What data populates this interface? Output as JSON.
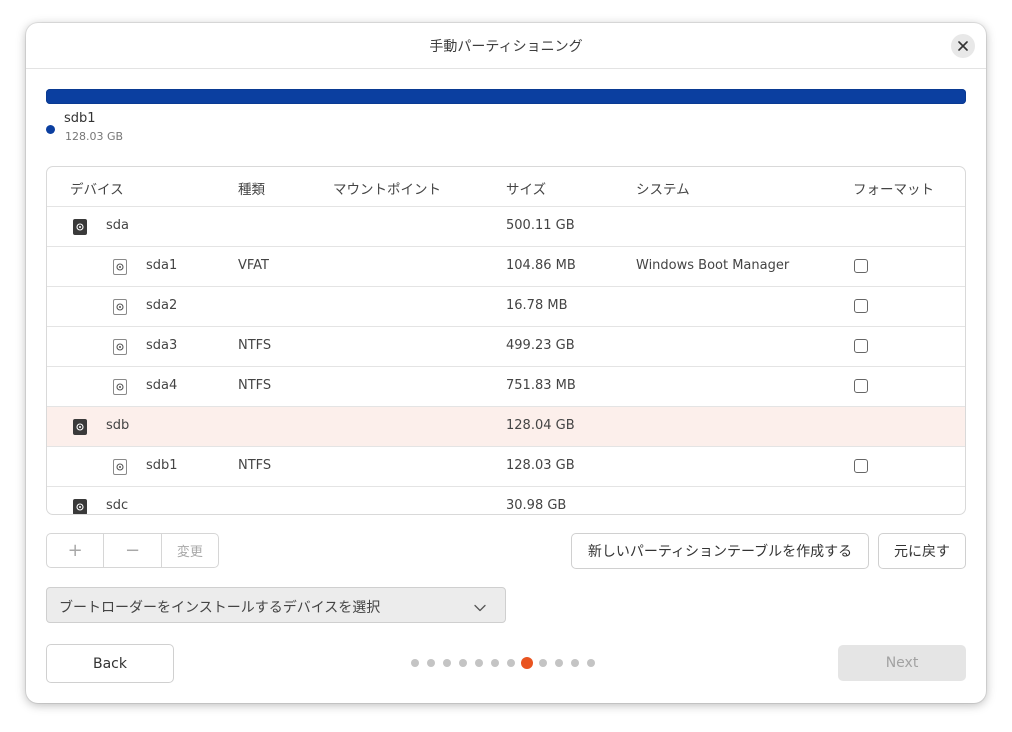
{
  "dialog": {
    "title": "手動パーティショニング",
    "close_icon": "close-icon"
  },
  "usage": {
    "bar_color": "#0b3fa0",
    "fill_fraction": 1.0,
    "legend": {
      "name": "sdb1",
      "size": "128.03 GB"
    }
  },
  "table": {
    "headers": {
      "device": "デバイス",
      "type": "種類",
      "mount": "マウントポイント",
      "size": "サイズ",
      "system": "システム",
      "format": "フォーマット"
    },
    "rows": [
      {
        "device": "sda",
        "type": "",
        "mount": "",
        "size": "500.11 GB",
        "system": "",
        "kind": "disk",
        "format_checkbox": false,
        "selected": false
      },
      {
        "device": "sda1",
        "type": "VFAT",
        "mount": "",
        "size": "104.86 MB",
        "system": "Windows Boot Manager",
        "kind": "partition",
        "format_checkbox": true,
        "selected": false
      },
      {
        "device": "sda2",
        "type": "",
        "mount": "",
        "size": "16.78 MB",
        "system": "",
        "kind": "partition",
        "format_checkbox": true,
        "selected": false
      },
      {
        "device": "sda3",
        "type": "NTFS",
        "mount": "",
        "size": "499.23 GB",
        "system": "",
        "kind": "partition",
        "format_checkbox": true,
        "selected": false
      },
      {
        "device": "sda4",
        "type": "NTFS",
        "mount": "",
        "size": "751.83 MB",
        "system": "",
        "kind": "partition",
        "format_checkbox": true,
        "selected": false
      },
      {
        "device": "sdb",
        "type": "",
        "mount": "",
        "size": "128.04 GB",
        "system": "",
        "kind": "disk",
        "format_checkbox": false,
        "selected": true
      },
      {
        "device": "sdb1",
        "type": "NTFS",
        "mount": "",
        "size": "128.03 GB",
        "system": "",
        "kind": "partition",
        "format_checkbox": true,
        "selected": false
      },
      {
        "device": "sdc",
        "type": "",
        "mount": "",
        "size": "30.98 GB",
        "system": "",
        "kind": "disk",
        "format_checkbox": false,
        "selected": false
      }
    ],
    "selected_color": "#fcefeb"
  },
  "actions": {
    "add_label": "+",
    "remove_label": "−",
    "change_label": "変更",
    "new_table_label": "新しいパーティションテーブルを作成する",
    "revert_label": "元に戻す"
  },
  "bootloader": {
    "selected": "ブートローダーをインストールするデバイスを選択",
    "chevron_icon": "chevron-down-icon"
  },
  "footer": {
    "back_label": "Back",
    "next_label": "Next",
    "next_enabled": false,
    "steps_total": 12,
    "current_step": 8,
    "accent": "#e95420"
  }
}
